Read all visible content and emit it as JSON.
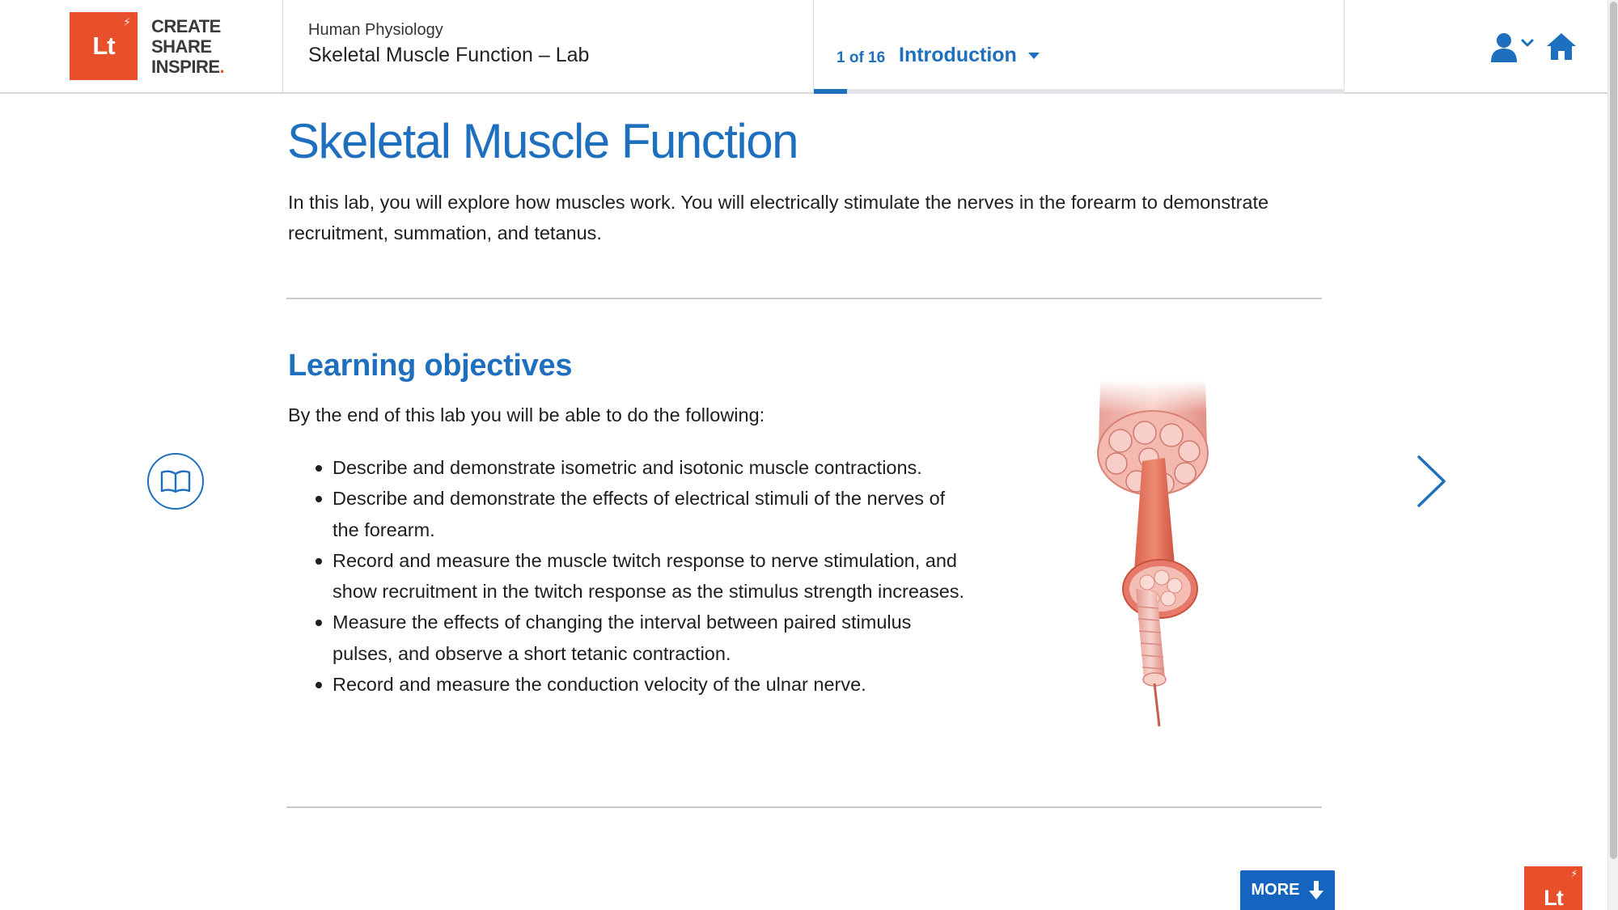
{
  "brand": {
    "logo_text": "Lt",
    "tagline": [
      "CREATE",
      "SHARE",
      "INSPIRE"
    ],
    "tagline_dot": ".",
    "accent_color": "#e8502c"
  },
  "header": {
    "course_subtitle": "Human Physiology",
    "course_title": "Skeletal Muscle Function – Lab",
    "page_count": "1 of 16",
    "section": "Introduction",
    "progress_fraction": 0.0625,
    "user_icon": "user-icon",
    "home_icon": "home-icon"
  },
  "main": {
    "title": "Skeletal Muscle Function",
    "intro": "In this lab, you will explore how muscles work. You will electrically stimulate the nerves in the forearm to demonstrate recruitment, summation, and tetanus.",
    "objectives": {
      "title": "Learning objectives",
      "lead": "By the end of this lab you will be able to do the following:",
      "items": [
        "Describe and demonstrate isometric and isotonic muscle contractions.",
        "Describe and demonstrate the effects of electrical stimuli of the nerves of the forearm.",
        "Record and measure the muscle twitch response to nerve stimulation, and show recruitment in the twitch response as the stimulus strength increases.",
        "Measure the effects of changing the interval between paired stimulus pulses, and observe a short tetanic contraction.",
        "Record and measure the conduction velocity of the ulnar nerve."
      ]
    }
  },
  "footer": {
    "more_label": "MORE",
    "corner_logo_text": "Lt"
  },
  "colors": {
    "primary": "#1f6fbf",
    "more_button": "#1565c0"
  }
}
